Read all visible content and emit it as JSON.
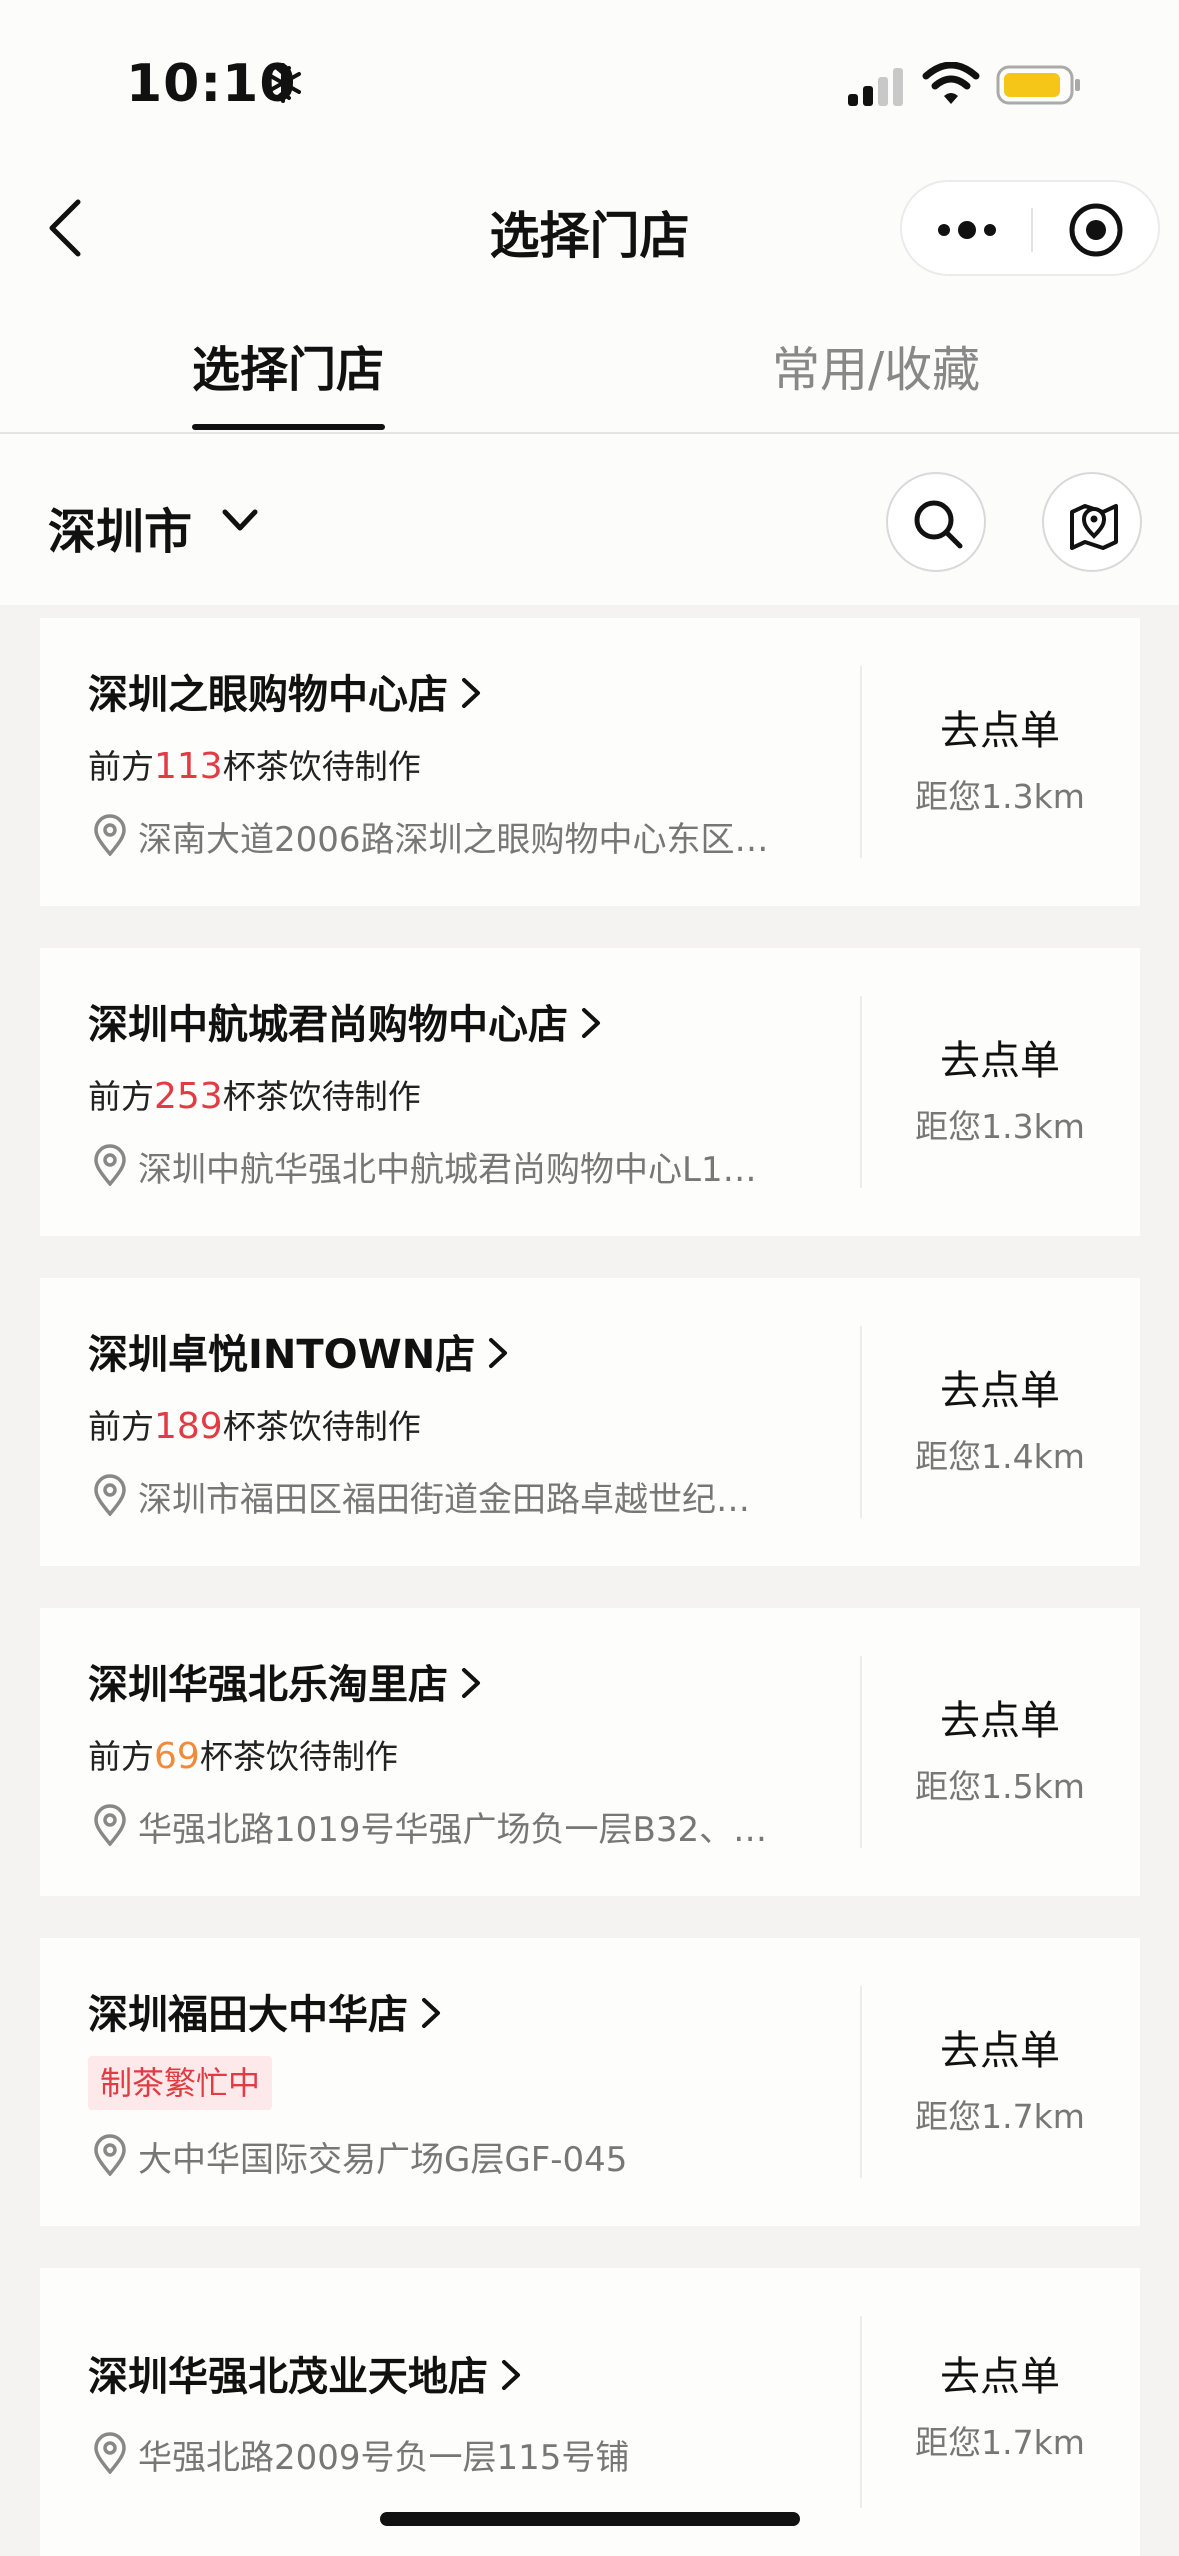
{
  "status_bar": {
    "time": "10:10"
  },
  "nav": {
    "title": "选择门店"
  },
  "tabs": [
    {
      "label": "选择门店",
      "active": true
    },
    {
      "label": "常用/收藏",
      "active": false
    }
  ],
  "city": {
    "label": "深圳市"
  },
  "stores": [
    {
      "name": "深圳之眼购物中心店",
      "queue_prefix": "前方",
      "queue_count": "113",
      "queue_suffix": "杯茶饮待制作",
      "queue_color": "#e23b44",
      "address": "深南大道2006路深圳之眼购物中心东区…",
      "order_label": "去点单",
      "distance": "距您1.3km"
    },
    {
      "name": "深圳中航城君尚购物中心店",
      "queue_prefix": "前方",
      "queue_count": "253",
      "queue_suffix": "杯茶饮待制作",
      "queue_color": "#e23b44",
      "address": "深圳中航华强北中航城君尚购物中心L1…",
      "order_label": "去点单",
      "distance": "距您1.3km"
    },
    {
      "name": "深圳卓悦INTOWN店",
      "queue_prefix": "前方",
      "queue_count": "189",
      "queue_suffix": "杯茶饮待制作",
      "queue_color": "#e23b44",
      "address": "深圳市福田区福田街道金田路卓越世纪…",
      "order_label": "去点单",
      "distance": "距您1.4km"
    },
    {
      "name": "深圳华强北乐淘里店",
      "queue_prefix": "前方",
      "queue_count": "69",
      "queue_suffix": "杯茶饮待制作",
      "queue_color": "#f08a3c",
      "address": "华强北路1019号华强广场负一层B32、…",
      "order_label": "去点单",
      "distance": "距您1.5km"
    },
    {
      "name": "深圳福田大中华店",
      "busy_label": "制茶繁忙中",
      "address": "大中华国际交易广场G层GF-045",
      "order_label": "去点单",
      "distance": "距您1.7km"
    },
    {
      "name": "深圳华强北茂业天地店",
      "address": "华强北路2009号负一层115号铺",
      "order_label": "去点单",
      "distance": "距您1.7km"
    }
  ]
}
